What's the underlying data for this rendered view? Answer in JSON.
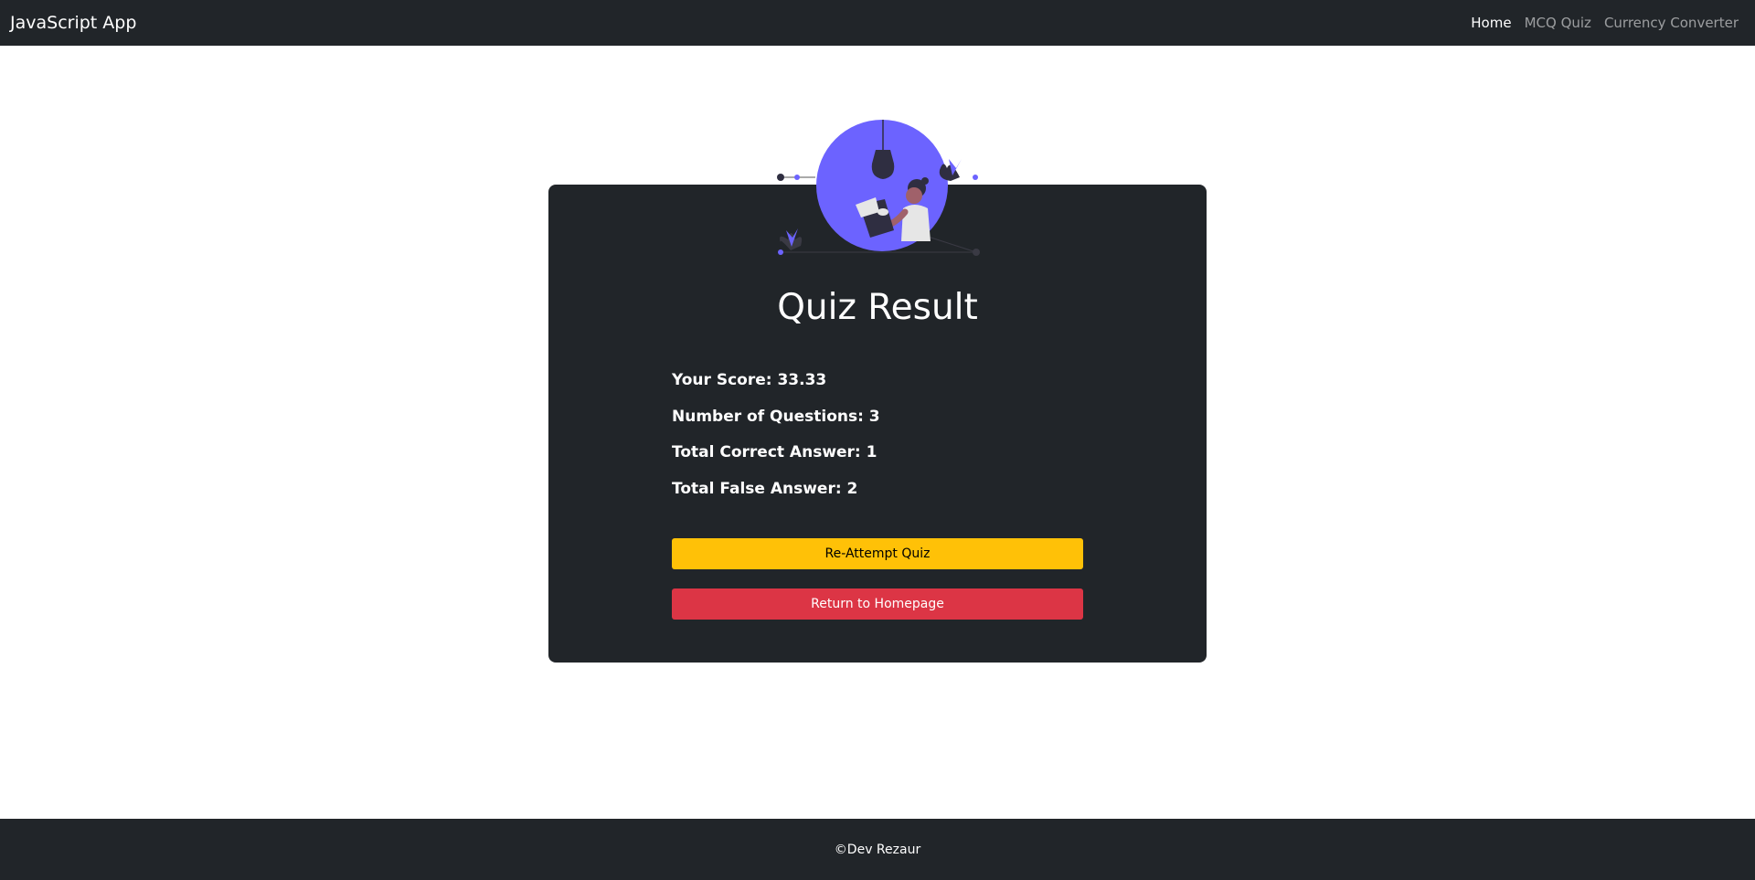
{
  "navbar": {
    "brand": "JavaScript App",
    "links": [
      {
        "label": "Home",
        "active": true
      },
      {
        "label": "MCQ Quiz",
        "active": false
      },
      {
        "label": "Currency Converter",
        "active": false
      }
    ]
  },
  "result": {
    "title": "Quiz Result",
    "stats": [
      "Your Score: 33.33",
      "Number of Questions: 3",
      "Total Correct Answer: 1",
      "Total False Answer: 2"
    ],
    "reattempt_label": "Re-Attempt Quiz",
    "home_label": "Return to Homepage"
  },
  "footer": {
    "text": "©Dev Rezaur"
  },
  "colors": {
    "dark": "#212529",
    "accent": "#6c63ff",
    "warning": "#ffc107",
    "danger": "#dc3545"
  },
  "icons": {
    "illustration": "reading-woman-illustration"
  }
}
